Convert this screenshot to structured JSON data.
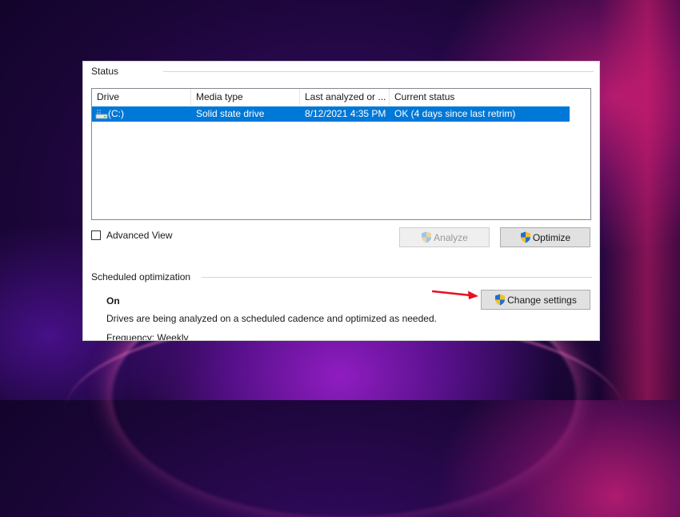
{
  "status_group": {
    "label": "Status"
  },
  "drive_list": {
    "columns": [
      "Drive",
      "Media type",
      "Last analyzed or ...",
      "Current status"
    ],
    "rows": [
      {
        "drive": "(C:)",
        "media_type": "Solid state drive",
        "last_analyzed": "8/12/2021 4:35 PM",
        "status": "OK (4 days since last retrim)",
        "selected": true,
        "icon": "drive-icon"
      }
    ]
  },
  "advanced_view": {
    "label": "Advanced View",
    "checked": false
  },
  "buttons": {
    "analyze": {
      "label": "Analyze",
      "enabled": false,
      "icon": "shield-icon"
    },
    "optimize": {
      "label": "Optimize",
      "enabled": true,
      "icon": "shield-icon"
    },
    "change_settings": {
      "label": "Change settings",
      "enabled": true,
      "icon": "shield-icon"
    }
  },
  "scheduled": {
    "label": "Scheduled optimization",
    "state": "On",
    "description": "Drives are being analyzed on a scheduled cadence and optimized as needed.",
    "frequency": "Frequency: Weekly"
  },
  "annotation": {
    "arrow_color": "#e81123"
  },
  "colors": {
    "selection": "#0078d7",
    "accent_focus": "#0078d7"
  }
}
